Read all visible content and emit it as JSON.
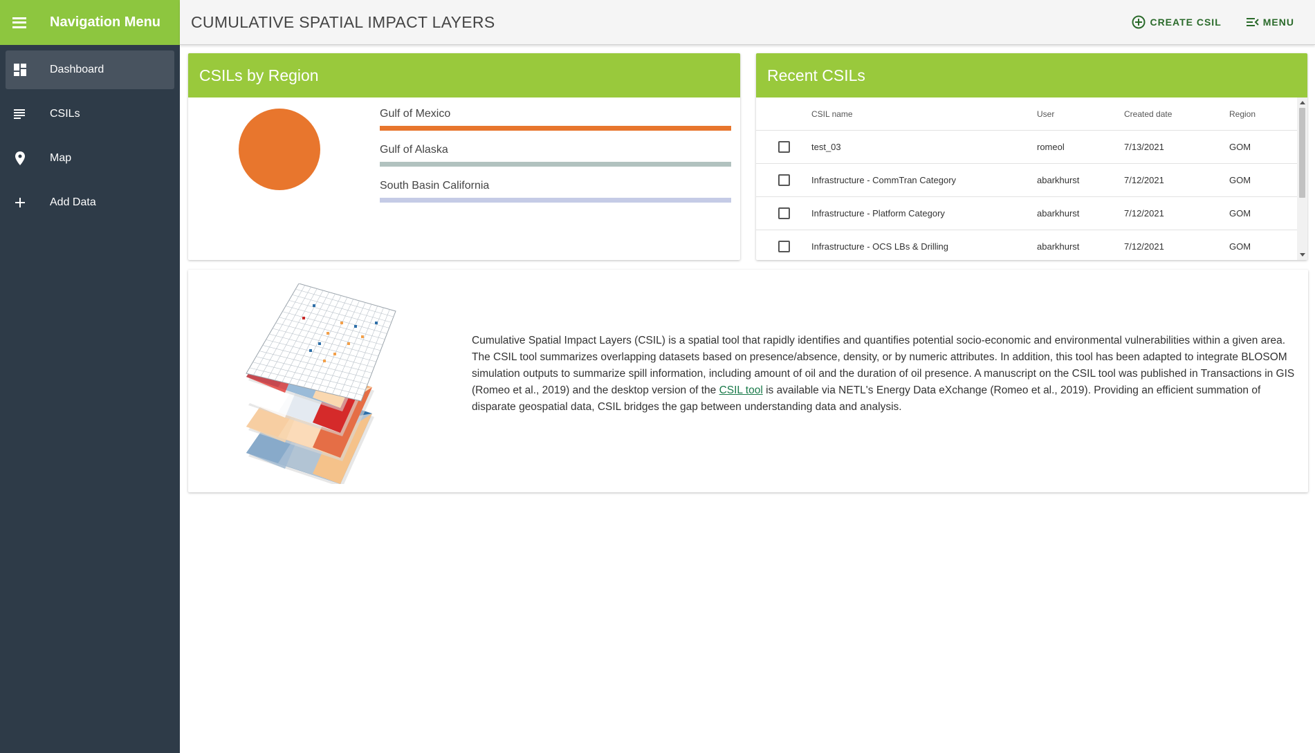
{
  "sidebar": {
    "title": "Navigation Menu",
    "items": [
      {
        "label": "Dashboard",
        "icon": "dashboard-icon",
        "active": true
      },
      {
        "label": "CSILs",
        "icon": "list-icon"
      },
      {
        "label": "Map",
        "icon": "map-pin-icon"
      },
      {
        "label": "Add Data",
        "icon": "plus-icon"
      }
    ]
  },
  "header": {
    "title": "CUMULATIVE SPATIAL IMPACT LAYERS",
    "create_label": "CREATE CSIL",
    "menu_label": "MENU"
  },
  "colors": {
    "accent_green": "#8dc63f",
    "card_header_green": "#99c93c",
    "sidebar_bg": "#2e3b48",
    "action_text": "#2a6a2a"
  },
  "region_card": {
    "title": "CSILs by Region",
    "legend": [
      {
        "name": "Gulf of Mexico",
        "color": "#e8762d"
      },
      {
        "name": "Gulf of Alaska",
        "color": "#b1c2bf"
      },
      {
        "name": "South Basin California",
        "color": "#c5cbe6"
      }
    ]
  },
  "chart_data": {
    "type": "pie",
    "categories": [
      "Gulf of Mexico",
      "Gulf of Alaska",
      "South Basin California"
    ],
    "values": [
      1,
      0,
      0
    ],
    "colors": [
      "#e8762d",
      "#b1c2bf",
      "#c5cbe6"
    ]
  },
  "recent_card": {
    "title": "Recent CSILs",
    "columns": [
      "CSIL name",
      "User",
      "Created date",
      "Region"
    ],
    "rows": [
      {
        "name": "test_03",
        "user": "romeol",
        "date": "7/13/2021",
        "region": "GOM"
      },
      {
        "name": "Infrastructure - CommTran Category",
        "user": "abarkhurst",
        "date": "7/12/2021",
        "region": "GOM"
      },
      {
        "name": "Infrastructure - Platform Category",
        "user": "abarkhurst",
        "date": "7/12/2021",
        "region": "GOM"
      },
      {
        "name": "Infrastructure - OCS LBs & Drilling",
        "user": "abarkhurst",
        "date": "7/12/2021",
        "region": "GOM"
      }
    ]
  },
  "description": {
    "text_before": "Cumulative Spatial Impact Layers (CSIL) is a spatial tool that rapidly identifies and quantifies potential socio-economic and environmental vulnerabilities within a given area. The CSIL tool summarizes overlapping datasets based on presence/absence, density, or by numeric attributes. In addition, this tool has been adapted to integrate BLOSOM simulation outputs to summarize spill information, including amount of oil and the duration of oil presence. A manuscript on the CSIL tool was published in Transactions in GIS (Romeo et al., 2019) and the desktop version of the ",
    "link_text": "CSIL tool",
    "text_after": " is available via NETL's Energy Data eXchange (Romeo et al., 2019). Providing an efficient summation of disparate geospatial data, CSIL bridges the gap between understanding data and analysis."
  }
}
